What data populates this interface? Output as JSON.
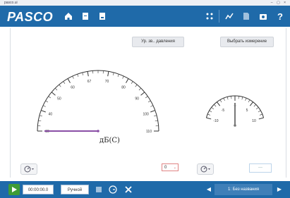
{
  "window": {
    "title": "pasco.ui",
    "buttons": "– ▢ ×"
  },
  "toolbar": {
    "logo": "PASCO",
    "icons": [
      "home-icon",
      "document-icon",
      "document-icon",
      "tools-icon",
      "graph-icon",
      "page-icon",
      "camera-icon",
      "help-icon"
    ],
    "help_label": "?"
  },
  "main": {
    "left_button": "Ур. зв.. давления",
    "right_button": "Выбрать измерение",
    "readout_unit": "дБ(C)",
    "left_gauge": {
      "ticks": [
        "30",
        "40",
        "50",
        "60",
        "67",
        "70",
        "80",
        "90",
        "100",
        "110"
      ],
      "needle_value": 30
    },
    "right_gauge": {
      "ticks": [
        "-10",
        "-5",
        "0",
        "5",
        "10"
      ],
      "needle_value": 0
    },
    "unit_select": "0",
    "empty_select": "---"
  },
  "bottom": {
    "time": "00:00:00.0",
    "mode": "Ручной",
    "page": "1: Без названия"
  },
  "colors": {
    "accent": "#1f6aa9",
    "needle": "#8a4fa6",
    "play": "#3f9c35"
  }
}
